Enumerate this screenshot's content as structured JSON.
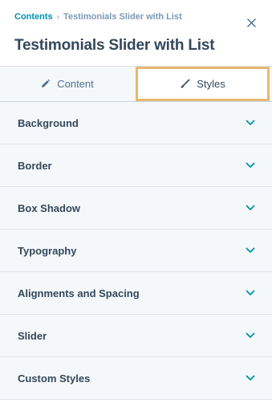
{
  "breadcrumb": {
    "parent": "Contents",
    "separator": "›",
    "current": "Testimonials Slider with List"
  },
  "header": {
    "title": "Testimonials Slider with List"
  },
  "tabs": [
    {
      "label": "Content",
      "icon": "pencil-icon",
      "selected": false
    },
    {
      "label": "Styles",
      "icon": "brush-icon",
      "selected": true
    }
  ],
  "sections": [
    {
      "label": "Background"
    },
    {
      "label": "Border"
    },
    {
      "label": "Box Shadow"
    },
    {
      "label": "Typography"
    },
    {
      "label": "Alignments and Spacing"
    },
    {
      "label": "Slider"
    },
    {
      "label": "Custom Styles"
    }
  ],
  "colors": {
    "accent": "#0091ae",
    "text": "#33475b",
    "focus_outline": "#e8b770",
    "panel_bg": "#f5f8fa"
  }
}
